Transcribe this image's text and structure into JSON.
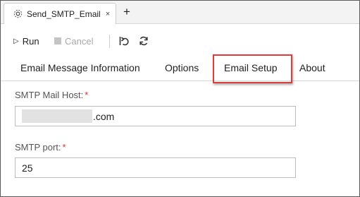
{
  "tab": {
    "label": "Send_SMTP_Email",
    "close": "×",
    "add": "+"
  },
  "toolbar": {
    "run_glyph": "▷",
    "run_label": "Run",
    "cancel_label": "Cancel"
  },
  "subtabs": [
    "Email Message Information",
    "Options",
    "Email Setup",
    "About"
  ],
  "form": {
    "host_label": "SMTP Mail Host:",
    "host_value": ".com",
    "port_label": "SMTP port:",
    "port_value": "25",
    "required_mark": "*"
  },
  "colors": {
    "highlight": "#e03c3c",
    "required": "#d9302c"
  },
  "icons": [
    "workflow-icon",
    "play-icon",
    "stop-icon",
    "undo-icon",
    "refresh-icon"
  ]
}
